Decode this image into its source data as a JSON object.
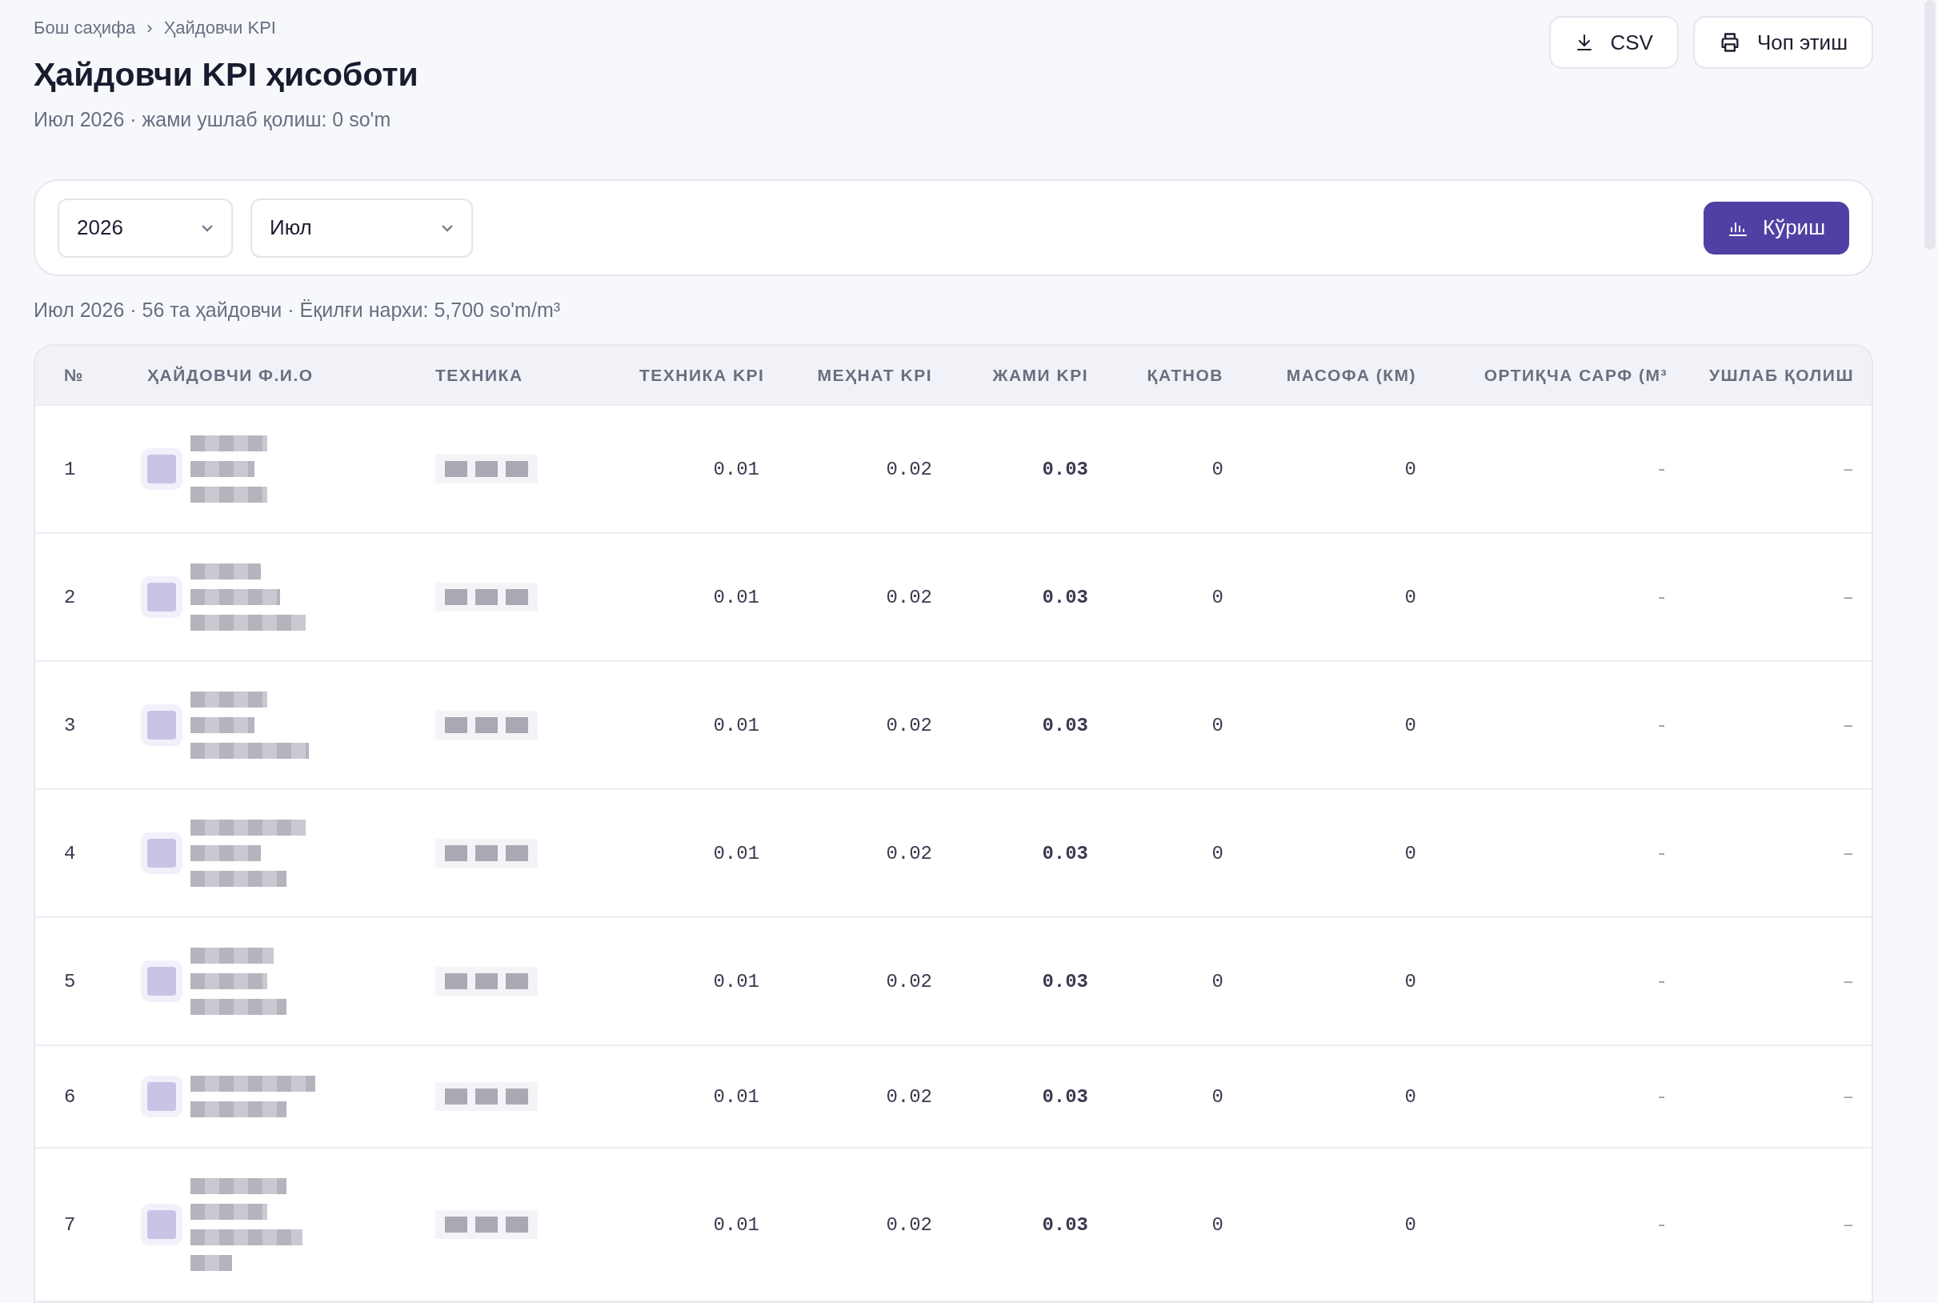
{
  "breadcrumb": {
    "items": [
      {
        "label": "Бош саҳифа"
      },
      {
        "label": "Ҳайдовчи KPI"
      }
    ],
    "separator": "›"
  },
  "title": "Ҳайдовчи KPI ҳисоботи",
  "subtitle": "Июл 2026 · жами ушлаб қолиш: 0 so'm",
  "actions": [
    {
      "kind": "download",
      "label": "CSV"
    },
    {
      "kind": "print",
      "label": "Чоп этиш"
    }
  ],
  "filters": {
    "selects": [
      {
        "value": "2026"
      },
      {
        "value": "Июл"
      }
    ],
    "submit": {
      "label": "Кўриш"
    }
  },
  "summary": "Июл 2026 · 56 та ҳайдовчи · Ёқилғи нархи: 5,700 so'm/m³",
  "table": {
    "columns": [
      "№",
      "ҲАЙДОВЧИ Ф.И.О",
      "ТЕХНИКА",
      "ТЕХНИКА KPI",
      "МЕҲНАТ KPI",
      "ЖАМИ KPI",
      "ҚАТНОВ",
      "МАСОФА (КМ)",
      "ОРТИҚЧА САРФ (М³",
      "УШЛАБ ҚОЛИШ"
    ],
    "rows": [
      {
        "number": "1",
        "technique_kpi": "0.01",
        "labor_kpi": "0.02",
        "total_kpi": "0.03",
        "trips": "0",
        "distance": "0",
        "overuse": "-",
        "deduction": "–"
      },
      {
        "number": "2",
        "technique_kpi": "0.01",
        "labor_kpi": "0.02",
        "total_kpi": "0.03",
        "trips": "0",
        "distance": "0",
        "overuse": "-",
        "deduction": "–"
      },
      {
        "number": "3",
        "technique_kpi": "0.01",
        "labor_kpi": "0.02",
        "total_kpi": "0.03",
        "trips": "0",
        "distance": "0",
        "overuse": "-",
        "deduction": "–"
      },
      {
        "number": "4",
        "technique_kpi": "0.01",
        "labor_kpi": "0.02",
        "total_kpi": "0.03",
        "trips": "0",
        "distance": "0",
        "overuse": "-",
        "deduction": "–"
      },
      {
        "number": "5",
        "technique_kpi": "0.01",
        "labor_kpi": "0.02",
        "total_kpi": "0.03",
        "trips": "0",
        "distance": "0",
        "overuse": "-",
        "deduction": "–"
      },
      {
        "number": "6",
        "technique_kpi": "0.01",
        "labor_kpi": "0.02",
        "total_kpi": "0.03",
        "trips": "0",
        "distance": "0",
        "overuse": "-",
        "deduction": "–"
      },
      {
        "number": "7",
        "technique_kpi": "0.01",
        "labor_kpi": "0.02",
        "total_kpi": "0.03",
        "trips": "0",
        "distance": "0",
        "overuse": "-",
        "deduction": "–"
      }
    ]
  }
}
